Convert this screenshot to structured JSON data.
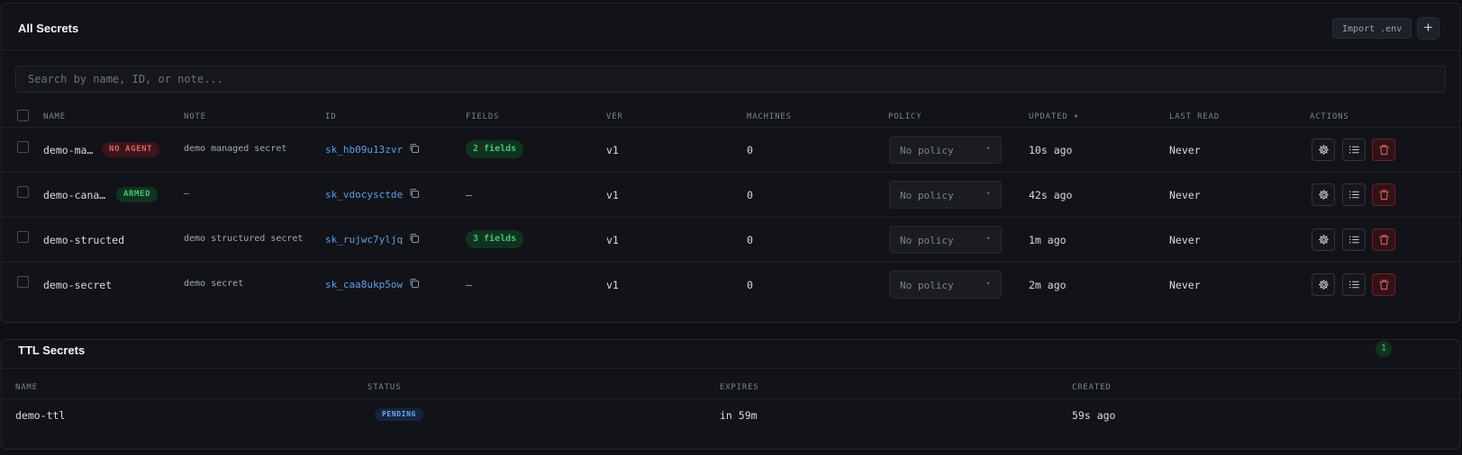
{
  "secrets_panel": {
    "title": "All Secrets",
    "import_label": "Import .env",
    "add_label": "+",
    "search_placeholder": "Search by name, ID, or note...",
    "columns": [
      "NAME",
      "NOTE",
      "ID",
      "FIELDS",
      "VER",
      "MACHINES",
      "POLICY",
      "UPDATED ▾",
      "LAST READ",
      "ACTIONS"
    ],
    "rows": [
      {
        "name": "demo-ma…",
        "badge": "NO AGENT",
        "note": "demo managed secret",
        "id": "sk_hb09u13zvr",
        "fields": "2 fields",
        "ver": "v1",
        "machines": "0",
        "policy": "No policy",
        "updated": "10s ago",
        "last_read": "Never"
      },
      {
        "name": "demo-cana…",
        "badge": "ARMED",
        "note": "–",
        "id": "sk_vdocysctde",
        "fields": "–",
        "ver": "v1",
        "machines": "0",
        "policy": "No policy",
        "updated": "42s ago",
        "last_read": "Never"
      },
      {
        "name": "demo-structed",
        "badge": "",
        "note": "demo structured secret",
        "id": "sk_rujwc7yljq",
        "fields": "3 fields",
        "ver": "v1",
        "machines": "0",
        "policy": "No policy",
        "updated": "1m ago",
        "last_read": "Never"
      },
      {
        "name": "demo-secret",
        "badge": "",
        "note": "demo secret",
        "id": "sk_caa8ukp5ow",
        "fields": "–",
        "ver": "v1",
        "machines": "0",
        "policy": "No policy",
        "updated": "2m ago",
        "last_read": "Never"
      }
    ],
    "policy_caret": "▾"
  },
  "ttl_panel": {
    "title": "TTL Secrets",
    "count": "1",
    "columns": [
      "NAME",
      "STATUS",
      "EXPIRES",
      "CREATED"
    ],
    "rows": [
      {
        "name": "demo-ttl",
        "status": "PENDING",
        "expires": "in 59m",
        "created": "59s ago"
      }
    ]
  },
  "colors": {
    "background": "#0e1015",
    "panel": "#111318",
    "id_link": "#5f9de6",
    "badge_red": "#e35e64",
    "badge_green": "#43c273",
    "badge_blue": "#6ea6ee"
  },
  "icons": [
    "copy-icon",
    "gear-icon",
    "list-icon",
    "trash-icon"
  ]
}
